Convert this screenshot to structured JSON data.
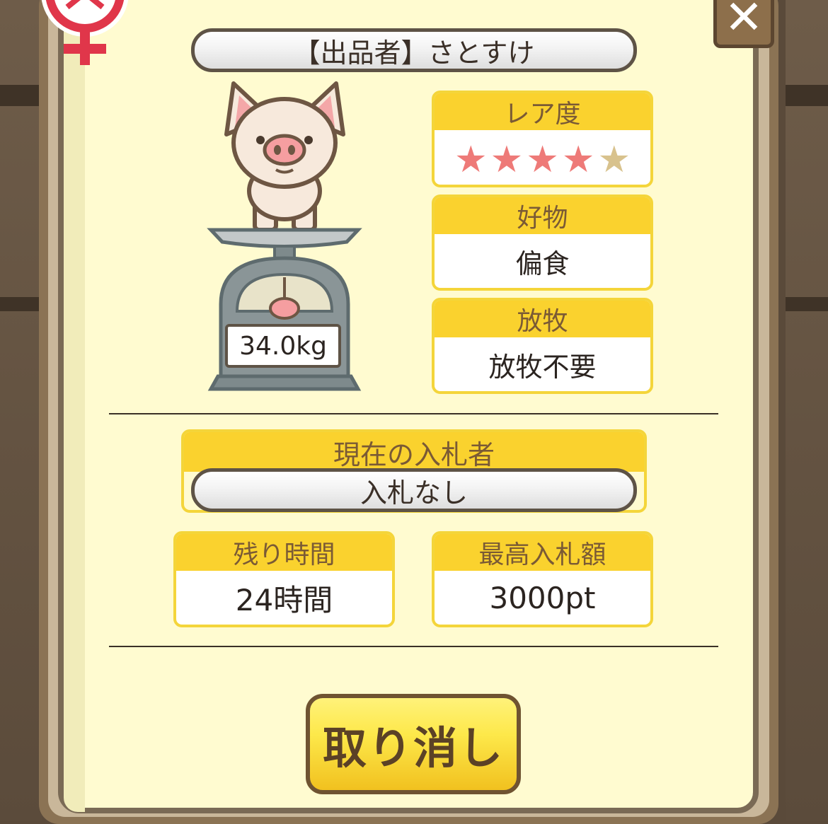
{
  "seller": {
    "label": "【出品者】さとすけ"
  },
  "rarity": {
    "title": "レア度",
    "stars_filled": 4,
    "stars_total": 5
  },
  "favorite_food": {
    "title": "好物",
    "value": "偏食"
  },
  "grazing": {
    "title": "放牧",
    "value": "放牧不要"
  },
  "current_bidder": {
    "title": "現在の入札者",
    "value": "入札なし"
  },
  "remaining_time": {
    "title": "残り時間",
    "value": "24時間"
  },
  "highest_bid": {
    "title": "最高入札額",
    "value": "3000pt"
  },
  "pig": {
    "weight": "34.0kg",
    "gender_icon": "female-icon"
  },
  "actions": {
    "cancel_label": "取り消し",
    "close_icon": "close-icon"
  },
  "colors": {
    "panel_bg": "#fffbd0",
    "box_header": "#fad22e",
    "star_on": "#ee7a78",
    "star_off": "#d8c28d",
    "button": "#fde84a"
  }
}
